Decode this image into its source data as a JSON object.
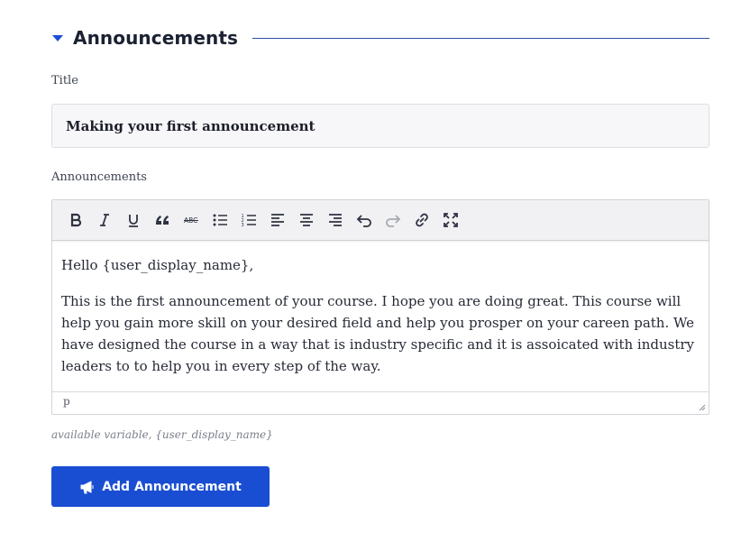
{
  "section": {
    "title": "Announcements",
    "collapse_icon": "caret-down-icon",
    "accent_color": "#1c4fd8"
  },
  "title_field": {
    "label": "Title",
    "value": "Making your first announcement"
  },
  "announcement_field": {
    "label": "Announcements",
    "toolbar": [
      {
        "name": "bold",
        "icon": "bold-icon"
      },
      {
        "name": "italic",
        "icon": "italic-icon"
      },
      {
        "name": "underline",
        "icon": "underline-icon"
      },
      {
        "name": "blockquote",
        "icon": "blockquote-icon"
      },
      {
        "name": "strikethrough",
        "icon": "strikethrough-icon",
        "text": "ABC"
      },
      {
        "name": "bullet-list",
        "icon": "bullet-list-icon"
      },
      {
        "name": "numbered-list",
        "icon": "numbered-list-icon"
      },
      {
        "name": "align-left",
        "icon": "align-left-icon"
      },
      {
        "name": "align-center",
        "icon": "align-center-icon"
      },
      {
        "name": "align-right",
        "icon": "align-right-icon"
      },
      {
        "name": "undo",
        "icon": "undo-icon"
      },
      {
        "name": "redo",
        "icon": "redo-icon",
        "disabled": true
      },
      {
        "name": "link",
        "icon": "link-icon"
      },
      {
        "name": "fullscreen",
        "icon": "fullscreen-icon"
      }
    ],
    "body": {
      "greeting": "Hello {user_display_name},",
      "paragraph": "This is the first announcement of your course. I hope you are doing great. This course will help you gain more skill on your desired field and help you prosper on your careen path. We have designed the course in a way that is industry specific and it is assoicated with industry leaders to to help you in every step of the way."
    },
    "status_path": "p"
  },
  "hint": "available variable, {user_display_name}",
  "submit_button": {
    "label": "Add Announcement",
    "icon": "megaphone-icon",
    "color": "#1a4ed2"
  }
}
